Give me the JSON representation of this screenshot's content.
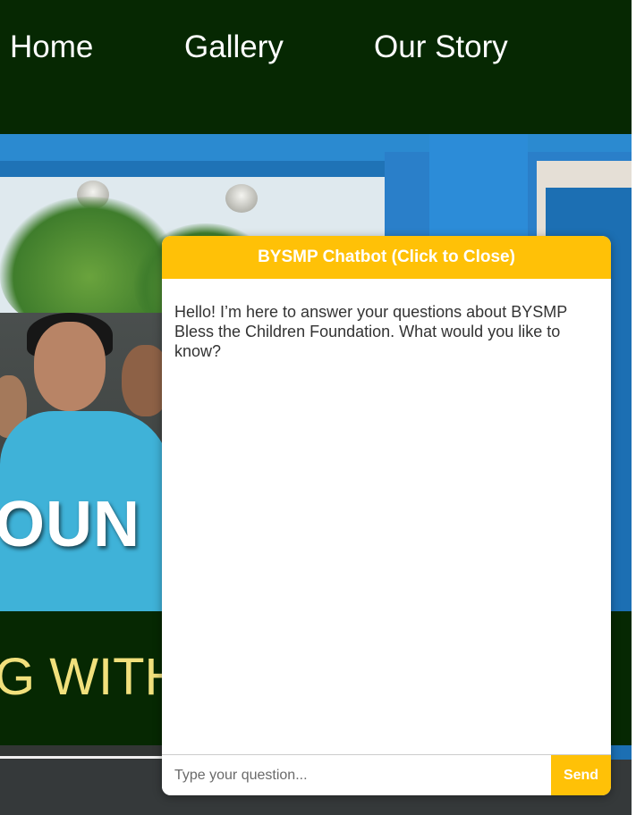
{
  "nav": {
    "items": [
      {
        "label": "Home"
      },
      {
        "label": "Gallery"
      },
      {
        "label": "Our Story"
      }
    ]
  },
  "hero": {
    "title_fragment": "OUN",
    "band_fragment": "G WITH"
  },
  "chatbot": {
    "header": "BYSMP Chatbot (Click to Close)",
    "messages": [
      {
        "from": "bot",
        "text": "Hello! I’m here to answer your questions about BYSMP Bless the Children Foundation. What would you like to know?"
      }
    ],
    "input_placeholder": "Type your question...",
    "send_label": "Send"
  },
  "colors": {
    "nav_bg": "#062802",
    "accent": "#ffc107",
    "band_text": "#f1e07c"
  }
}
